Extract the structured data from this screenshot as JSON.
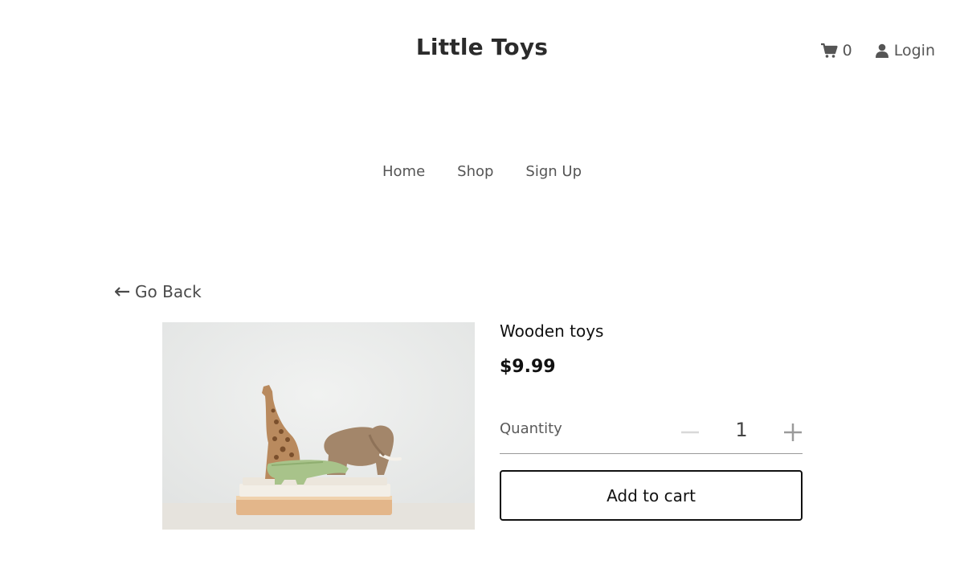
{
  "header": {
    "brand": "Little Toys",
    "cart_count": "0",
    "login_label": "Login"
  },
  "nav": {
    "items": [
      {
        "label": "Home"
      },
      {
        "label": "Shop"
      },
      {
        "label": "Sign Up"
      }
    ]
  },
  "go_back": {
    "label": "Go Back"
  },
  "product": {
    "title": "Wooden toys",
    "price": "$9.99",
    "quantity_label": "Quantity",
    "quantity_value": "1",
    "add_to_cart_label": "Add to cart"
  },
  "icons": {
    "cart": "cart-icon",
    "login": "user-icon",
    "back": "arrow-left-icon",
    "minus": "minus-icon",
    "plus": "plus-icon"
  },
  "colors": {
    "text": "#333333",
    "muted": "#555555",
    "button_border": "#111111"
  }
}
